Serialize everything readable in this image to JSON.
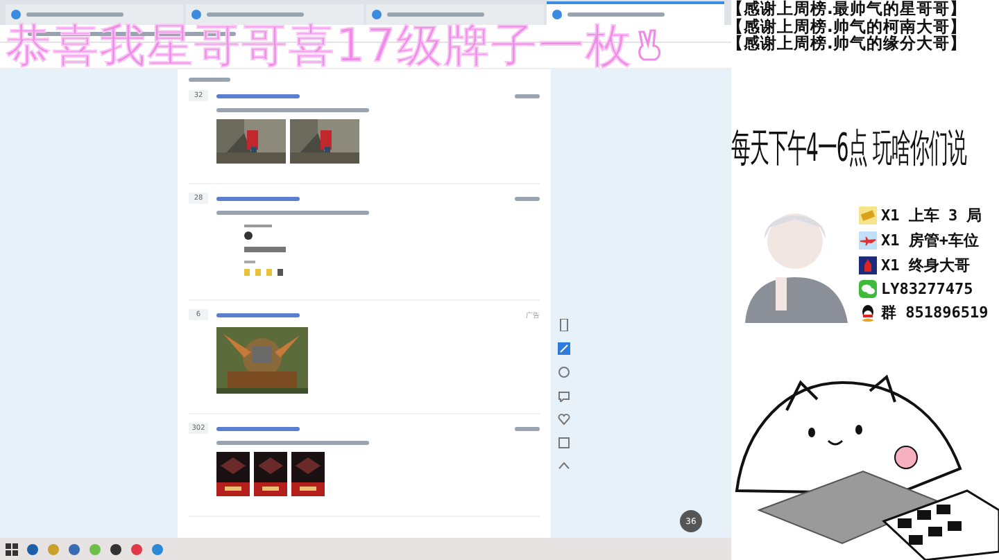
{
  "banner": {
    "text": "恭喜我星哥哥喜17级牌子一枚"
  },
  "browser": {
    "tabs": [
      {
        "selected": false
      },
      {
        "selected": false
      },
      {
        "selected": false
      },
      {
        "selected": true
      }
    ],
    "posts": [
      {
        "replies": "32"
      },
      {
        "replies": "28",
        "media": [
          {
            "kind": "stats"
          }
        ]
      },
      {
        "replies": "6",
        "ad_label": "广告"
      },
      {
        "replies": "302"
      }
    ],
    "bubble": "36"
  },
  "thanks": [
    "【感谢上周榜.最帅气的星哥哥】",
    "【感谢上周榜.帅气的柯南大哥】",
    "【感谢上周榜.帅气的缘分大哥】"
  ],
  "schedule": "每天下午4一6点 玩啥你们说",
  "perks": [
    {
      "kind": "ticket",
      "text": "X1 上车 3 局"
    },
    {
      "kind": "plane",
      "text": "X1 房管+车位"
    },
    {
      "kind": "rocket",
      "text": "X1 终身大哥"
    },
    {
      "kind": "wechat",
      "text": "LY83277475"
    },
    {
      "kind": "qq",
      "text": "群 851896519"
    }
  ]
}
